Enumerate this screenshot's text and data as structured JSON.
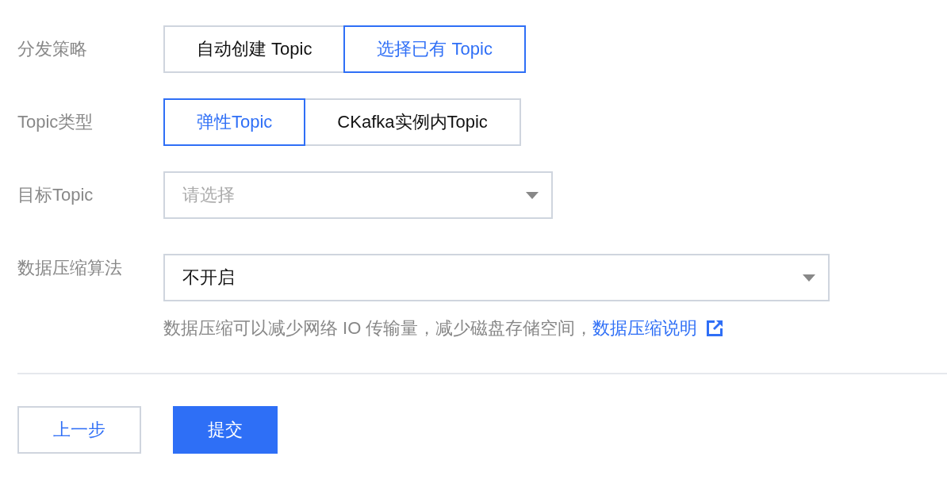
{
  "fields": [
    {
      "kind": "segmented",
      "label": "分发策略",
      "options": [
        {
          "label": "自动创建 Topic",
          "selected": false
        },
        {
          "label": "选择已有 Topic",
          "selected": true
        }
      ]
    },
    {
      "kind": "segmented",
      "label": "Topic类型",
      "options": [
        {
          "label": "弹性Topic",
          "selected": true
        },
        {
          "label": "CKafka实例内Topic",
          "selected": false
        }
      ]
    },
    {
      "kind": "select",
      "label": "目标Topic",
      "placeholder": "请选择"
    },
    {
      "kind": "select",
      "label": "数据压缩算法",
      "value": "不开启",
      "help": {
        "text": "数据压缩可以减少网络 IO 传输量，减少磁盘存储空间，",
        "link": "数据压缩说明"
      }
    }
  ],
  "buttons": [
    {
      "kind": "secondary",
      "label": "上一步"
    },
    {
      "kind": "primary",
      "label": "提交"
    }
  ]
}
